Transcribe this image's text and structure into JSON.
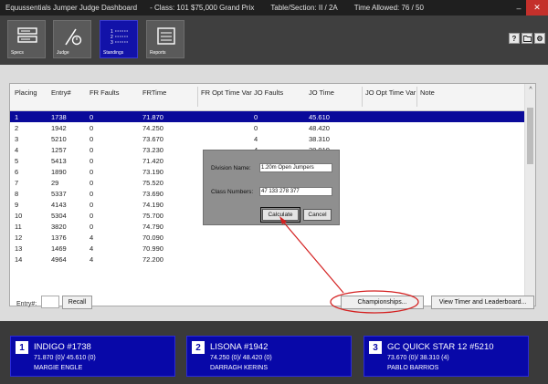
{
  "titlebar": {
    "app_title": "Equussentials Jumper Judge Dashboard",
    "class_info": "- Class: 101 $75,000 Grand Prix",
    "table_section": "Table/Section: II / 2A",
    "time_allowed": "Time Allowed: 76 / 50",
    "minimize_icon": "minimize-icon",
    "close_icon": "close-icon"
  },
  "toolbar": {
    "tools": [
      {
        "label": "Specs",
        "icon": "specs-icon"
      },
      {
        "label": "Judge",
        "icon": "judge-icon"
      },
      {
        "label": "Standings",
        "icon": "standings-icon"
      },
      {
        "label": "Reports",
        "icon": "reports-icon"
      }
    ],
    "active_tool": "Standings",
    "help_glyph": "?",
    "right_icons": [
      "help-icon",
      "folder-icon",
      "settings-icon"
    ]
  },
  "grid": {
    "columns": [
      "Placing",
      "Entry#",
      "FR Faults",
      "FRTime",
      "FR Opt Time Var",
      "JO Faults",
      "JO Time",
      "JO Opt Time Var",
      "Note"
    ],
    "rows": [
      [
        "1",
        "1738",
        "0",
        "71.870",
        "",
        "0",
        "45.610",
        "",
        ""
      ],
      [
        "2",
        "1942",
        "0",
        "74.250",
        "",
        "0",
        "48.420",
        "",
        ""
      ],
      [
        "3",
        "5210",
        "0",
        "73.670",
        "",
        "4",
        "38.310",
        "",
        ""
      ],
      [
        "4",
        "1257",
        "0",
        "73.230",
        "",
        "4",
        "38.910",
        "",
        ""
      ],
      [
        "5",
        "5413",
        "0",
        "71.420",
        "",
        "",
        "",
        "",
        ""
      ],
      [
        "6",
        "1890",
        "0",
        "73.190",
        "",
        "",
        "",
        "",
        ""
      ],
      [
        "7",
        "29",
        "0",
        "75.520",
        "",
        "",
        "",
        "",
        ""
      ],
      [
        "8",
        "5337",
        "0",
        "73.690",
        "",
        "",
        "",
        "",
        ""
      ],
      [
        "9",
        "4143",
        "0",
        "74.190",
        "",
        "",
        "",
        "",
        ""
      ],
      [
        "10",
        "5304",
        "0",
        "75.700",
        "",
        "",
        "",
        "",
        ""
      ],
      [
        "11",
        "3820",
        "0",
        "74.790",
        "",
        "",
        "",
        "",
        ""
      ],
      [
        "12",
        "1376",
        "4",
        "70.090",
        "",
        "",
        "",
        "",
        ""
      ],
      [
        "13",
        "1469",
        "4",
        "70.990",
        "",
        "",
        "",
        "",
        ""
      ],
      [
        "14",
        "4964",
        "4",
        "72.200",
        "",
        "",
        "",
        "",
        ""
      ]
    ],
    "selected_row": 0,
    "scroll_up_glyph": "^",
    "scroll_down_glyph": "v"
  },
  "dialog": {
    "division_label": "Division Name:",
    "division_value": "1.20m Open Jumpers",
    "class_numbers_label": "Class Numbers:",
    "class_numbers_value": "47 133 278 377",
    "calculate_label": "Calculate",
    "cancel_label": "Cancel"
  },
  "controls": {
    "entry_label": "Entry#:",
    "entry_value": "",
    "recall_label": "Recall",
    "championships_label": "Championships...",
    "view_timer_label": "View Timer and Leaderboard..."
  },
  "annotation": {
    "color": "#d42020"
  },
  "leaders": [
    {
      "place": "1",
      "horse": "INDIGO #1738",
      "times": "71.870 (0)/ 45.610 (0)",
      "rider": "MARGIE ENGLE"
    },
    {
      "place": "2",
      "horse": "LISONA #1942",
      "times": "74.250 (0)/ 48.420 (0)",
      "rider": "DARRAGH KERINS"
    },
    {
      "place": "3",
      "horse": "GC QUICK STAR 12 #5210",
      "times": "73.670 (0)/ 38.310 (4)",
      "rider": "PABLO BARRIOS"
    }
  ],
  "colors": {
    "accent": "#0a0a9a",
    "titlebar": "#1f1f1f",
    "toolbar": "#3f3f3f",
    "footer": "#3a3a3a"
  }
}
